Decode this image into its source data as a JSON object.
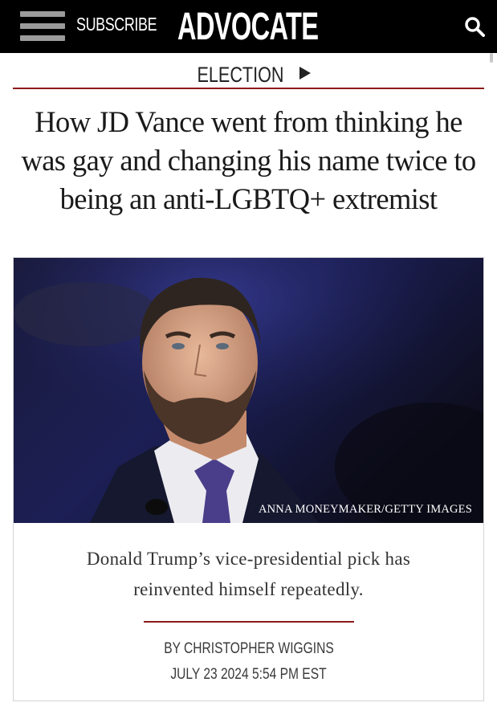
{
  "header": {
    "subscribe_label": "SUBSCRIBE",
    "logo_text": "ADVOCATE",
    "icons": {
      "menu": "hamburger-menu-icon",
      "search": "search-icon"
    }
  },
  "section": {
    "label": "ELECTION",
    "icon": "play-arrow-icon"
  },
  "article": {
    "headline": "How JD Vance went from thinking he was gay and changing his name twice to being an anti-LGBTQ+ extremist",
    "photo_caption": "ANNA MONEYMAKER/GETTY IMAGES",
    "dek": "Donald Trump’s vice-presidential pick has reinvented himself repeatedly.",
    "byline": "BY CHRISTOPHER WIGGINS",
    "date": "JULY 23 2024 5:54 PM EST"
  },
  "colors": {
    "accent_red": "#8b1a1a",
    "header_bg": "#000000"
  }
}
